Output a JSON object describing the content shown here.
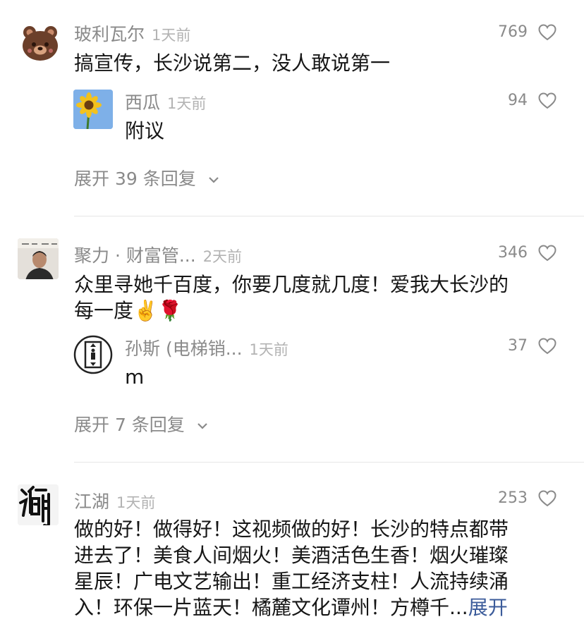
{
  "comments": [
    {
      "name": "玻利瓦尔",
      "time": "1天前",
      "likes": "769",
      "text": "搞宣传，长沙说第二，没人敢说第一",
      "reply": {
        "name": "西瓜",
        "time": "1天前",
        "likes": "94",
        "text": "附议"
      },
      "expand": "展开 39 条回复"
    },
    {
      "name": "聚力 · 财富管...",
      "time": "2天前",
      "likes": "346",
      "text_line1": "众里寻她千百度，你要几度就几度！爱我大长沙的",
      "text_line2": "每一度✌️🌹",
      "reply": {
        "name": "孙斯 (电梯销...",
        "time": "1天前",
        "likes": "37",
        "text": "m"
      },
      "expand": "展开 7 条回复"
    },
    {
      "name": "江湖",
      "time": "1天前",
      "likes": "253",
      "text_lines": [
        "做的好！做得好！这视频做的好！长沙的特点都带",
        "进去了！美食人间烟火！美酒活色生香！烟火璀璨",
        "星辰！广电文艺输出！重工经济支柱！人流持续涌",
        "入！环保一片蓝天！橘麓文化谭州！方樽千..."
      ],
      "more": "展开"
    }
  ],
  "icons": {
    "like": "heart-outline-icon",
    "chevron": "chevron-down-icon"
  },
  "colors": {
    "accent_link": "#3b5b9a",
    "meta": "#8a8a8a",
    "divider": "#e6e6e6"
  }
}
